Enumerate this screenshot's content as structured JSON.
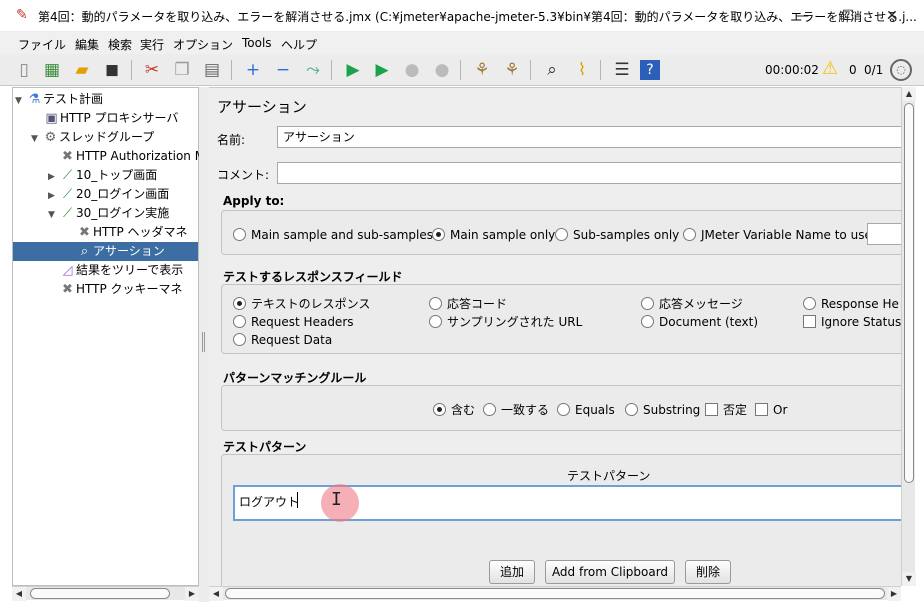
{
  "window": {
    "title": "第4回：動的パラメータを取り込み、エラーを解消させる.jmx (C:¥jmeter¥apache-jmeter-5.3¥bin¥第4回：動的パラメータを取り込み、エラーを解消させる.j...",
    "minimize": "—",
    "maximize": "☐",
    "close": "✕"
  },
  "menu": {
    "file": "ファイル",
    "edit": "編集",
    "search": "検索",
    "run": "実行",
    "options": "オプション",
    "tools": "Tools",
    "help": "ヘルプ"
  },
  "toolbar": {
    "elapsed": "00:00:02",
    "warning_count": "0",
    "threads": "0/1"
  },
  "tree": {
    "items": [
      {
        "label": "テスト計画"
      },
      {
        "label": "HTTP プロキシサーバ"
      },
      {
        "label": "スレッドグループ"
      },
      {
        "label": "HTTP Authorization M"
      },
      {
        "label": "10_トップ画面"
      },
      {
        "label": "20_ログイン画面"
      },
      {
        "label": "30_ログイン実施"
      },
      {
        "label": "HTTP ヘッダマネ"
      },
      {
        "label": "アサーション"
      },
      {
        "label": "結果をツリーで表示"
      },
      {
        "label": "HTTP クッキーマネ"
      }
    ]
  },
  "panel": {
    "title": "アサーション",
    "name_label": "名前:",
    "name_value": "アサーション",
    "comment_label": "コメント:",
    "comment_value": "",
    "apply_to": {
      "title": "Apply to:",
      "options": [
        "Main sample and sub-samples",
        "Main sample only",
        "Sub-samples only",
        "JMeter Variable Name to use"
      ],
      "selected": "Main sample only"
    },
    "response_field": {
      "title": "テストするレスポンスフィールド",
      "options": [
        "テキストのレスポンス",
        "応答コード",
        "応答メッセージ",
        "Response He",
        "Request Headers",
        "サンプリングされた URL",
        "Document (text)",
        "Request Data"
      ],
      "ignore_status": "Ignore Status",
      "selected": "テキストのレスポンス"
    },
    "matching": {
      "title": "パターンマッチングルール",
      "contains": "含む",
      "matches": "一致する",
      "equals": "Equals",
      "substring": "Substring",
      "not": "否定",
      "or": "Or",
      "selected": "含む"
    },
    "patterns": {
      "title": "テストパターン",
      "column_header": "テストパターン",
      "items": [
        "ログアウト"
      ]
    },
    "buttons": {
      "add": "追加",
      "add_clipboard": "Add from Clipboard",
      "delete": "削除"
    }
  },
  "colors": {
    "selection": "#3d6ea3",
    "warning": "#f2c200",
    "play": "#1aa34a",
    "cursor_highlight": "#f07a86"
  }
}
